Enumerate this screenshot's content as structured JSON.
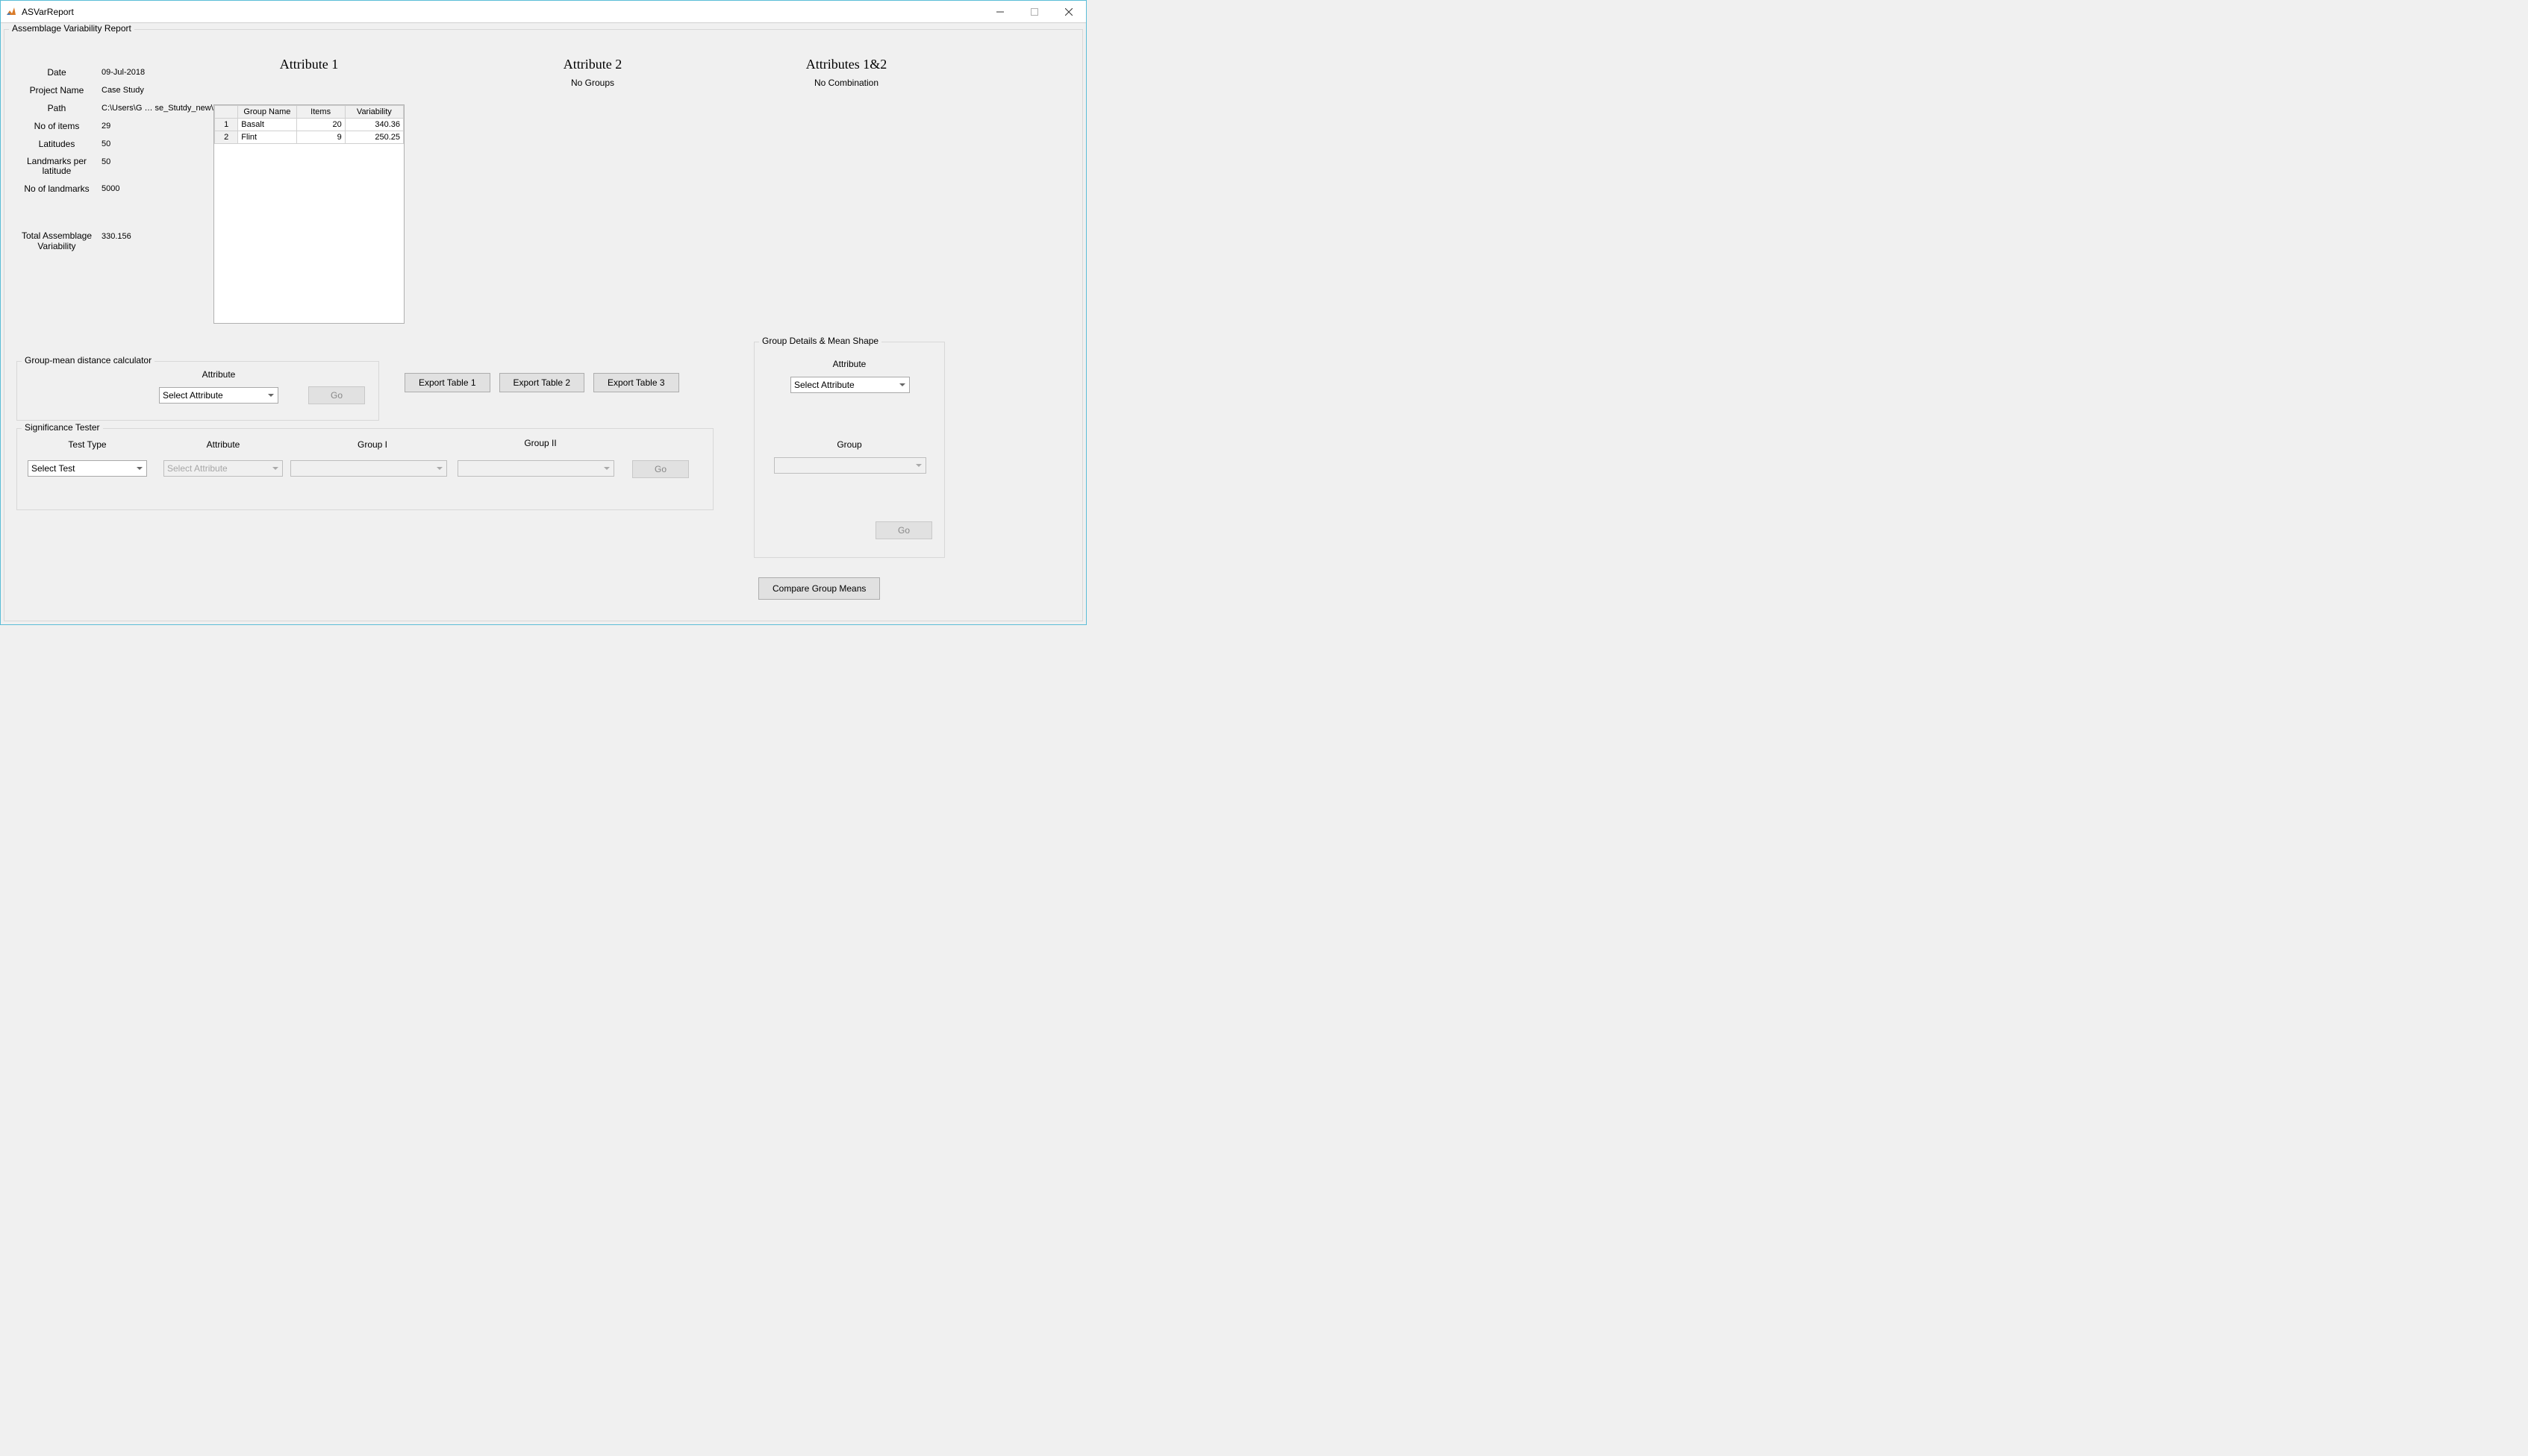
{
  "window": {
    "title": "ASVarReport"
  },
  "main": {
    "legend": "Assemblage Variability Report"
  },
  "info": {
    "date_label": "Date",
    "date_value": "09-Jul-2018",
    "project_label": "Project Name",
    "project_value": "Case Study",
    "path_label": "Path",
    "path_value": "C:\\Users\\G … se_Stutdy_new\\",
    "items_label": "No of items",
    "items_value": "29",
    "lat_label": "Latitudes",
    "lat_value": "50",
    "lpl_label": "Landmarks per latitude",
    "lpl_value": "50",
    "lm_label": "No of landmarks",
    "lm_value": "5000",
    "tav_label": "Total Assemblage Variability",
    "tav_value": "330.156"
  },
  "columns": {
    "attr1": "Attribute 1",
    "attr2": "Attribute 2",
    "attr12": "Attributes 1&2",
    "no_groups": "No Groups",
    "no_combo": "No Combination"
  },
  "table1": {
    "headers": {
      "group": "Group Name",
      "items": "Items",
      "var": "Variability"
    },
    "rows": [
      {
        "idx": "1",
        "name": "Basalt",
        "items": "20",
        "var": "340.36"
      },
      {
        "idx": "2",
        "name": "Flint",
        "items": "9",
        "var": "250.25"
      }
    ]
  },
  "gmd": {
    "legend": "Group-mean distance calculator",
    "attribute_label": "Attribute",
    "select_placeholder": "Select Attribute",
    "go": "Go"
  },
  "export": {
    "t1": "Export Table 1",
    "t2": "Export Table 2",
    "t3": "Export Table 3"
  },
  "sig": {
    "legend": "Significance Tester",
    "test_type": "Test Type",
    "attribute": "Attribute",
    "g1": "Group I",
    "g2": "Group II",
    "select_test": "Select Test",
    "select_attr": "Select Attribute",
    "go": "Go"
  },
  "gd": {
    "legend": "Group Details & Mean Shape",
    "attribute": "Attribute",
    "select_attr": "Select Attribute",
    "group": "Group",
    "go": "Go"
  },
  "compare": {
    "label": "Compare Group Means"
  }
}
